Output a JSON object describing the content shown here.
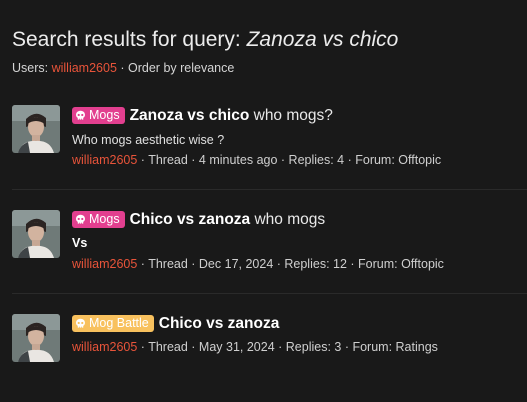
{
  "header": {
    "title_prefix": "Search results for query: ",
    "query": "Zanoza vs chico",
    "users_label": "Users: ",
    "user": "william2605",
    "order_text": " · Order by relevance"
  },
  "results": [
    {
      "label": "Mogs",
      "label_color": "#e23f8f",
      "title": "Zanoza vs chico",
      "title_suffix": " who mogs?",
      "snippet": "Who mogs aesthetic wise ?",
      "author": "william2605",
      "meta": " · Thread · 4 minutes ago · Replies: 4 · Forum: Offtopic"
    },
    {
      "label": "Mogs",
      "label_color": "#e23f8f",
      "title": "Chico vs zanoza",
      "title_suffix": " who mogs",
      "snippet": "Vs",
      "author": "william2605",
      "meta": " · Thread · Dec 17, 2024 · Replies: 12 · Forum: Offtopic"
    },
    {
      "label": "Mog Battle",
      "label_color": "#f8c15e",
      "title": "Chico vs zanoza",
      "title_suffix": "",
      "author": "william2605",
      "meta": " · Thread · May 31, 2024 · Replies: 3 · Forum: Ratings"
    }
  ],
  "colors": {
    "background": "#191919",
    "link": "#e8543a"
  },
  "icons": {
    "label_icon": "skull-icon"
  }
}
